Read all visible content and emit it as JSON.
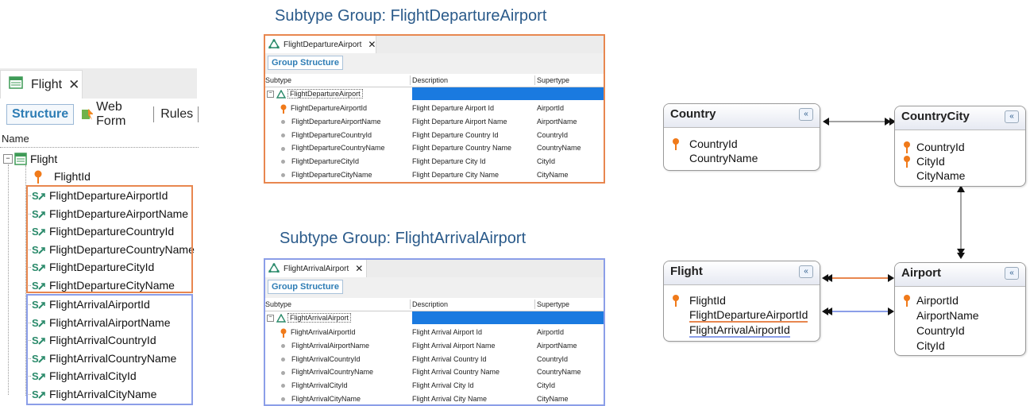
{
  "left": {
    "tab_label": "Flight",
    "tab_close": "✕",
    "subtabs": {
      "structure": "Structure",
      "web_form": "Web Form",
      "rules": "Rules"
    },
    "column_header": "Name",
    "tree": {
      "root": "Flight",
      "key": "FlightId",
      "departure": [
        "FlightDepartureAirportId",
        "FlightDepartureAirportName",
        "FlightDepartureCountryId",
        "FlightDepartureCountryName",
        "FlightDepartureCityId",
        "FlightDepartureCityName"
      ],
      "arrival": [
        "FlightArrivalAirportId",
        "FlightArrivalAirportName",
        "FlightArrivalCountryId",
        "FlightArrivalCountryName",
        "FlightArrivalCityId",
        "FlightArrivalCityName"
      ]
    }
  },
  "departure_group": {
    "title": "Subtype Group: FlightDepartureAirport",
    "tab_label": "FlightDepartureAirport",
    "tab_close": "✕",
    "toolbar": "Group Structure",
    "headers": {
      "subtype": "Subtype",
      "description": "Description",
      "supertype": "Supertype"
    },
    "root": "FlightDepartureAirport",
    "rows": [
      {
        "subtype": "FlightDepartureAirportId",
        "description": "Flight Departure Airport Id",
        "supertype": "AirportId"
      },
      {
        "subtype": "FlightDepartureAirportName",
        "description": "Flight Departure Airport Name",
        "supertype": "AirportName"
      },
      {
        "subtype": "FlightDepartureCountryId",
        "description": "Flight Departure Country Id",
        "supertype": "CountryId"
      },
      {
        "subtype": "FlightDepartureCountryName",
        "description": "Flight Departure Country Name",
        "supertype": "CountryName"
      },
      {
        "subtype": "FlightDepartureCityId",
        "description": "Flight Departure City Id",
        "supertype": "CityId"
      },
      {
        "subtype": "FlightDepartureCityName",
        "description": "Flight Departure City Name",
        "supertype": "CityName"
      }
    ]
  },
  "arrival_group": {
    "title": "Subtype Group: FlightArrivalAirport",
    "tab_label": "FlightArrivalAirport",
    "tab_close": "✕",
    "toolbar": "Group Structure",
    "headers": {
      "subtype": "Subtype",
      "description": "Description",
      "supertype": "Supertype"
    },
    "root": "FlightArrivalAirport",
    "rows": [
      {
        "subtype": "FlightArrivalAirportId",
        "description": "Flight Arrival Airport Id",
        "supertype": "AirportId"
      },
      {
        "subtype": "FlightArrivalAirportName",
        "description": "Flight Arrival Airport Name",
        "supertype": "AirportName"
      },
      {
        "subtype": "FlightArrivalCountryId",
        "description": "Flight Arrival Country Id",
        "supertype": "CountryId"
      },
      {
        "subtype": "FlightArrivalCountryName",
        "description": "Flight Arrival Country Name",
        "supertype": "CountryName"
      },
      {
        "subtype": "FlightArrivalCityId",
        "description": "Flight Arrival City Id",
        "supertype": "CityId"
      },
      {
        "subtype": "FlightArrivalCityName",
        "description": "Flight Arrival City Name",
        "supertype": "CityName"
      }
    ]
  },
  "diagram": {
    "country": {
      "name": "Country",
      "attrs": [
        "CountryId",
        "CountryName"
      ]
    },
    "countrycity": {
      "name": "CountryCity",
      "attrs": [
        "CountryId",
        "CityId",
        "CityName"
      ]
    },
    "flight": {
      "name": "Flight",
      "attrs": [
        "FlightId",
        "FlightDepartureAirportId",
        "FlightArrivalAirportId"
      ]
    },
    "airport": {
      "name": "Airport",
      "attrs": [
        "AirportId",
        "AirportName",
        "CountryId",
        "CityId"
      ]
    },
    "collapse_glyph": "«"
  },
  "colors": {
    "orange": "#e8874f",
    "blue": "#8b9ee8",
    "title": "#2a5a8a",
    "selection": "#1a7ae0"
  }
}
